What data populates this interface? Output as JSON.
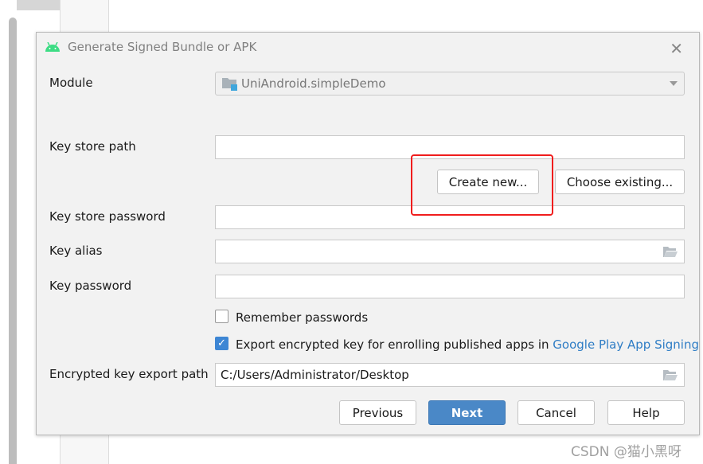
{
  "dialog": {
    "title": "Generate Signed Bundle or APK",
    "module": {
      "label": "Module",
      "value": "UniAndroid.simpleDemo"
    },
    "key_store_path": {
      "label": "Key store path",
      "value": ""
    },
    "create_new": "Create new...",
    "choose_existing": "Choose existing...",
    "key_store_password": {
      "label": "Key store password",
      "value": ""
    },
    "key_alias": {
      "label": "Key alias",
      "value": ""
    },
    "key_password": {
      "label": "Key password",
      "value": ""
    },
    "remember_passwords": {
      "label": "Remember passwords",
      "checked": false
    },
    "export_key": {
      "label": "Export encrypted key for enrolling published apps in",
      "link": "Google Play App Signing",
      "checked": true
    },
    "export_path": {
      "label": "Encrypted key export path",
      "value": "C:/Users/Administrator/Desktop"
    },
    "buttons": {
      "previous": "Previous",
      "next": "Next",
      "cancel": "Cancel",
      "help": "Help"
    }
  },
  "watermark": "CSDN @猫小黑呀",
  "colors": {
    "primary": "#4a88c7",
    "link": "#2f7dc5",
    "highlight": "#f01d1d",
    "android": "#3ddc84"
  }
}
